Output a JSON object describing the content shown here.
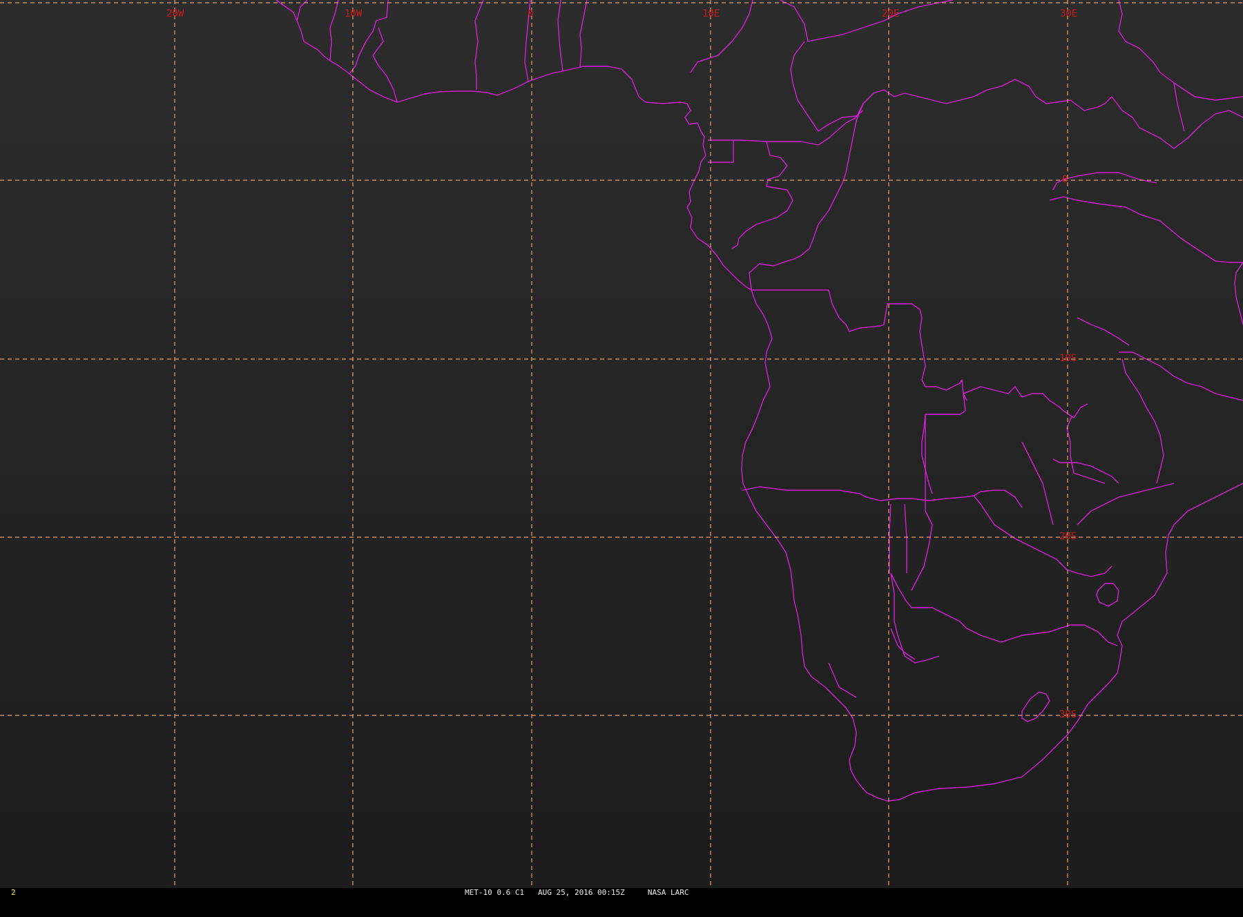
{
  "map": {
    "background_color": "#232323",
    "grid_color": "#e8a070",
    "label_color": "#cc1a1a",
    "boundary_color": "#d61ed6",
    "longitude_labels": [
      "20W",
      "10W",
      "0",
      "10E",
      "20E",
      "30E"
    ],
    "latitude_labels": [
      "0",
      "10S",
      "20S",
      "30S"
    ]
  },
  "status_bar": {
    "frame_number": "2",
    "text": "MET-10 0.6 C1   AUG 25, 2016 00:15Z     NASA LARC"
  }
}
